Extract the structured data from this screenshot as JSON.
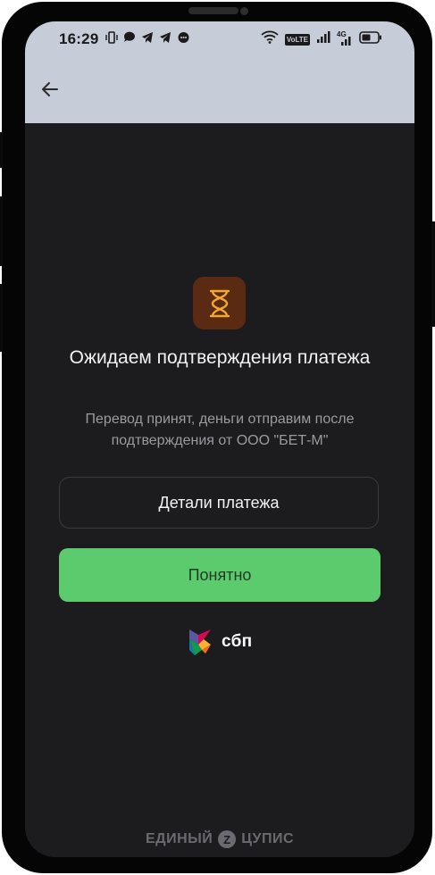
{
  "status_bar": {
    "time": "16:29",
    "left_icons": [
      "vibrate-icon",
      "chat-icon",
      "telegram-icon",
      "telegram-icon",
      "message-icon"
    ],
    "volte_label": "VoLTE",
    "net_label": "4G",
    "right_icons": [
      "wifi-icon",
      "volte-icon",
      "signal-icon",
      "signal-4g-icon",
      "battery-icon"
    ]
  },
  "app_bar": {
    "back_icon": "arrow-left-icon"
  },
  "main": {
    "status_icon": "hourglass-icon",
    "title": "Ожидаем подтверждения платежа",
    "subtitle": "Перевод принят, деньги отправим после подтверждения от ООО \"БЕТ-М\"",
    "details_button": "Детали платежа",
    "ok_button": "Понятно",
    "sbp_label": "сбп"
  },
  "footer": {
    "left_text": "ЕДИНЫЙ",
    "logo_letter": "Z",
    "right_text": "ЦУПИС"
  },
  "colors": {
    "background": "#1c1c1e",
    "header": "#c6ccd8",
    "accent_green": "#5ccb6e",
    "hourglass_bg": "#5a2a12",
    "hourglass_stroke": "#f0a830"
  }
}
